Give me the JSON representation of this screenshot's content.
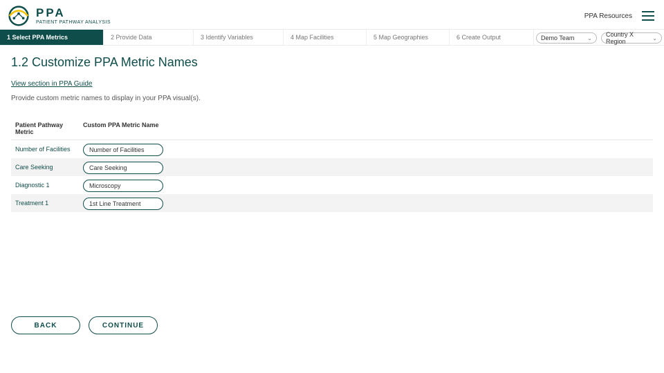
{
  "header": {
    "brand_title": "PPA",
    "brand_sub": "PATIENT PATHWAY ANALYSIS",
    "resources_link": "PPA Resources"
  },
  "steps": [
    {
      "label": "1 Select PPA Metrics",
      "active": true
    },
    {
      "label": "2 Provide Data"
    },
    {
      "label": "3 Identify Variables"
    },
    {
      "label": "4 Map Facilities"
    },
    {
      "label": "5 Map Geographies"
    },
    {
      "label": "6 Create Output"
    }
  ],
  "team_selector": "Demo Team",
  "region_selector": "Country X Region",
  "page": {
    "title": "1.2 Customize PPA Metric Names",
    "guide_link": "View section in PPA Guide",
    "description": "Provide custom metric names to display in your PPA visual(s)."
  },
  "table": {
    "col1": "Patient Pathway Metric",
    "col2": "Custom PPA Metric Name",
    "rows": [
      {
        "metric": "Number of Facilities",
        "value": "Number of Facilities"
      },
      {
        "metric": "Care Seeking",
        "value": "Care Seeking"
      },
      {
        "metric": "Diagnostic 1",
        "value": "Microscopy"
      },
      {
        "metric": "Treatment 1",
        "value": "1st Line Treatment"
      }
    ]
  },
  "buttons": {
    "back": "BACK",
    "continue": "CONTINUE"
  }
}
